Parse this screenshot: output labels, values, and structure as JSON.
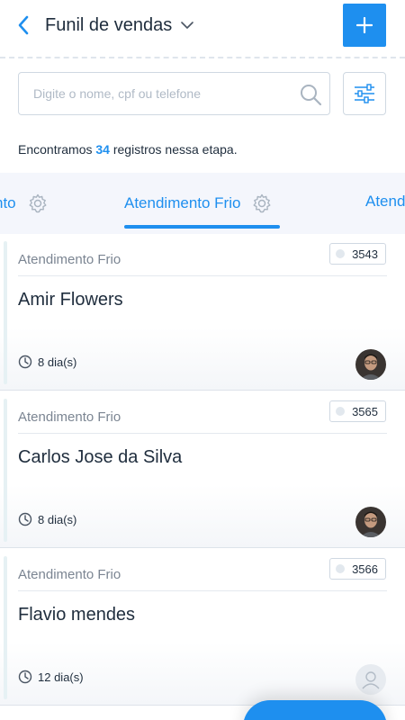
{
  "header": {
    "back_icon": "chevron-left-icon",
    "title": "Funil de vendas",
    "dropdown_icon": "chevron-down-icon",
    "add_icon": "plus-icon",
    "accent_color": "#1e8fef"
  },
  "search": {
    "placeholder": "Digite o nome, cpf ou telefone",
    "value": "",
    "icon": "search-icon",
    "filter_icon": "sliders-icon"
  },
  "summary": {
    "prefix": "Encontramos",
    "count": "34",
    "suffix": "registros nessa etapa."
  },
  "tabs": {
    "left": "nto",
    "active": "Atendimento Frio",
    "right": "Atend",
    "gear_icon": "gear-icon"
  },
  "cards": [
    {
      "stage": "Atendimento Frio",
      "code": "3543",
      "name": "Amir Flowers",
      "time": "8 dia(s)",
      "avatar": "photo"
    },
    {
      "stage": "Atendimento Frio",
      "code": "3565",
      "name": "Carlos Jose da Silva",
      "time": "8 dia(s)",
      "avatar": "photo"
    },
    {
      "stage": "Atendimento Frio",
      "code": "3566",
      "name": "Flavio mendes",
      "time": "12 dia(s)",
      "avatar": "placeholder-user-icon"
    }
  ]
}
